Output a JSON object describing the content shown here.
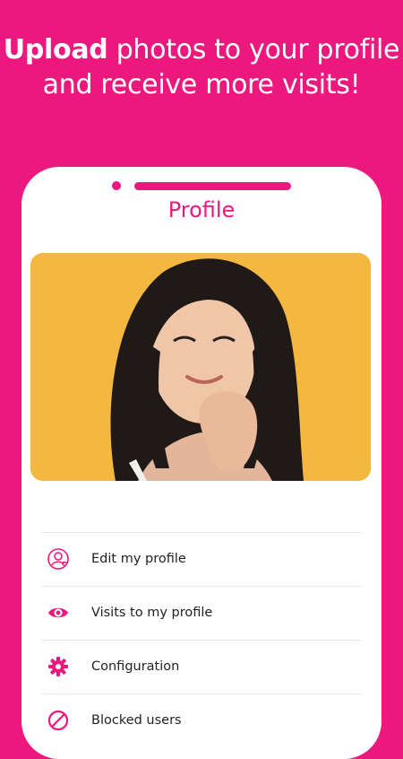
{
  "headline": {
    "bold": "Upload",
    "rest": " photos to your profile and receive more visits!"
  },
  "screen": {
    "title": "Profile"
  },
  "photo": {
    "alt": "Profile photo of a smiling woman on a yellow background"
  },
  "menu": {
    "items": [
      {
        "label": "Edit my profile",
        "icon": "edit-profile-icon"
      },
      {
        "label": "Visits to my profile",
        "icon": "eye-icon"
      },
      {
        "label": "Configuration",
        "icon": "gear-icon"
      },
      {
        "label": "Blocked users",
        "icon": "block-icon"
      }
    ]
  },
  "colors": {
    "accent": "#EC187E",
    "photo_bg": "#F4B740",
    "text": "#222222"
  }
}
